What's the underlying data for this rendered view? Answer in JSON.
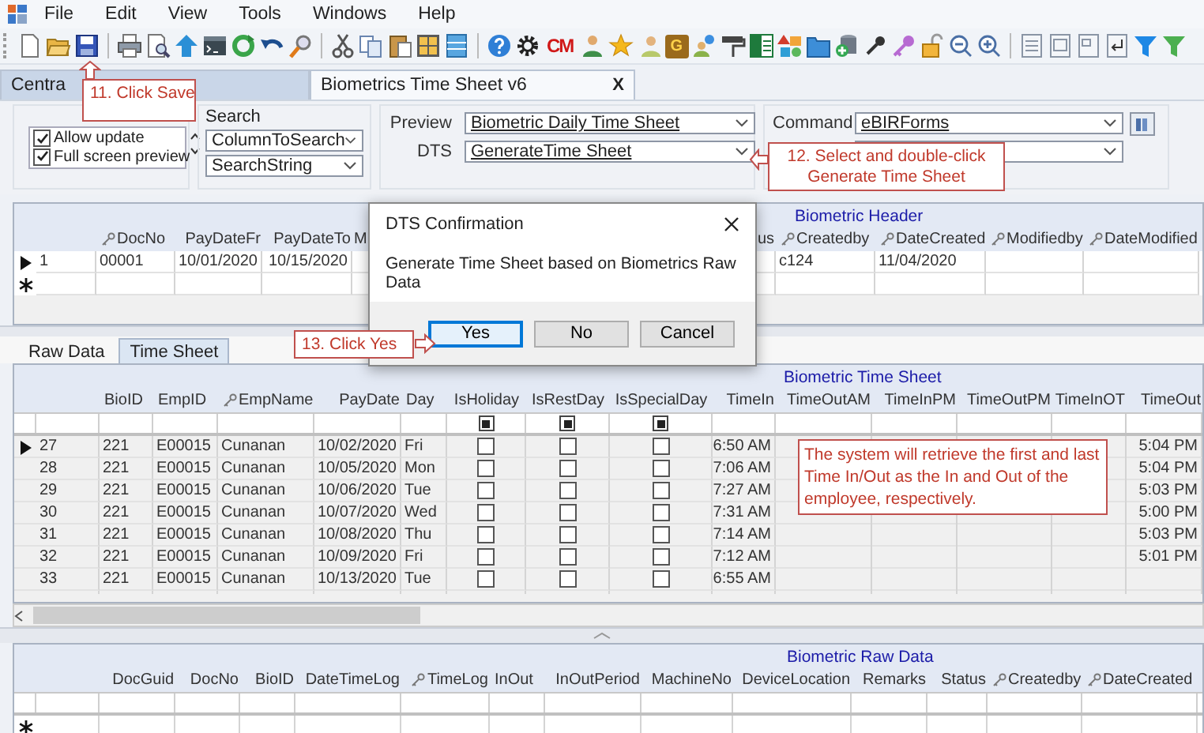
{
  "menu": [
    "File",
    "Edit",
    "View",
    "Tools",
    "Windows",
    "Help"
  ],
  "toolbar": {
    "cm_logo": "CM",
    "g_logo": "G"
  },
  "doc_tabs": [
    {
      "label": "Centra",
      "selected": false
    },
    {
      "label": "Biometrics Time Sheet v6",
      "selected": true,
      "close": "X"
    }
  ],
  "options": [
    {
      "label": "Allow update",
      "checked": true
    },
    {
      "label": "Full screen preview",
      "checked": true
    }
  ],
  "search": {
    "label": "Search",
    "column_field": "ColumnToSearch",
    "string_field": "SearchString"
  },
  "preview": {
    "label": "Preview",
    "value": "Biometric Daily Time Sheet"
  },
  "dts": {
    "label": "DTS",
    "value": "GenerateTime Sheet"
  },
  "command": {
    "label": "Command",
    "value": "eBIRForms"
  },
  "header_grid": {
    "title": "Biometric Header",
    "new_row": true,
    "columns": [
      {
        "label": "DocNo",
        "key": true,
        "kind": "text"
      },
      {
        "label": "PayDateFr",
        "key": false,
        "kind": "text"
      },
      {
        "label": "PayDateTo",
        "key": false,
        "kind": "text"
      },
      {
        "label": "M",
        "key": false,
        "kind": "text"
      },
      {
        "label": "us",
        "key": false,
        "kind": "text"
      },
      {
        "label": "Createdby",
        "key": true,
        "kind": "text"
      },
      {
        "label": "DateCreated",
        "key": true,
        "kind": "text"
      },
      {
        "label": "Modifiedby",
        "key": true,
        "kind": "text"
      },
      {
        "label": "DateModified",
        "key": true,
        "kind": "text"
      }
    ],
    "rows": [
      {
        "current": true,
        "number": "1",
        "cells": [
          "00001",
          "10/01/2020",
          "10/15/2020",
          null,
          null,
          "c124",
          "11/04/2020",
          null,
          null
        ]
      }
    ]
  },
  "dialog": {
    "title": "DTS Confirmation",
    "message": "Generate Time Sheet based on Biometrics Raw Data",
    "buttons": [
      {
        "label": "Yes",
        "focused": true
      },
      {
        "label": "No",
        "focused": false
      },
      {
        "label": "Cancel",
        "focused": false
      }
    ]
  },
  "sub_tabs": [
    {
      "label": "Raw Data",
      "selected": false
    },
    {
      "label": "Time Sheet",
      "selected": true
    }
  ],
  "time_sheet": {
    "title": "Biometric Time Sheet",
    "new_row": false,
    "columns": [
      {
        "label": "BioID",
        "key": false,
        "kind": "text"
      },
      {
        "label": "EmpID",
        "key": false,
        "kind": "text"
      },
      {
        "label": "EmpName",
        "key": true,
        "kind": "text"
      },
      {
        "label": "PayDate",
        "key": false,
        "kind": "text"
      },
      {
        "label": "Day",
        "key": false,
        "kind": "text"
      },
      {
        "label": "IsHoliday",
        "key": false,
        "kind": "check",
        "filter_indeterminate": true
      },
      {
        "label": "IsRestDay",
        "key": false,
        "kind": "check",
        "filter_indeterminate": true
      },
      {
        "label": "IsSpecialDay",
        "key": false,
        "kind": "check",
        "filter_indeterminate": true
      },
      {
        "label": "TimeIn",
        "key": false,
        "kind": "text"
      },
      {
        "label": "TimeOutAM",
        "key": false,
        "kind": "text"
      },
      {
        "label": "TimeInPM",
        "key": false,
        "kind": "text"
      },
      {
        "label": "TimeOutPM",
        "key": false,
        "kind": "text"
      },
      {
        "label": "TimeInOT",
        "key": false,
        "kind": "text"
      },
      {
        "label": "TimeOut",
        "key": false,
        "kind": "text"
      }
    ],
    "rows": [
      {
        "current": true,
        "number": "27",
        "cells": [
          "221",
          "E00015",
          "Cunanan",
          "10/02/2020",
          "Fri",
          false,
          false,
          false,
          "6:50 AM",
          null,
          null,
          null,
          null,
          "5:04 PM"
        ]
      },
      {
        "current": false,
        "number": "28",
        "cells": [
          "221",
          "E00015",
          "Cunanan",
          "10/05/2020",
          "Mon",
          false,
          false,
          false,
          "7:06 AM",
          null,
          null,
          null,
          null,
          "5:04 PM"
        ]
      },
      {
        "current": false,
        "number": "29",
        "cells": [
          "221",
          "E00015",
          "Cunanan",
          "10/06/2020",
          "Tue",
          false,
          false,
          false,
          "7:27 AM",
          null,
          null,
          null,
          null,
          "5:03 PM"
        ]
      },
      {
        "current": false,
        "number": "30",
        "cells": [
          "221",
          "E00015",
          "Cunanan",
          "10/07/2020",
          "Wed",
          false,
          false,
          false,
          "7:31 AM",
          null,
          null,
          null,
          null,
          "5:00 PM"
        ]
      },
      {
        "current": false,
        "number": "31",
        "cells": [
          "221",
          "E00015",
          "Cunanan",
          "10/08/2020",
          "Thu",
          false,
          false,
          false,
          "7:14 AM",
          null,
          null,
          null,
          null,
          "5:03 PM"
        ]
      },
      {
        "current": false,
        "number": "32",
        "cells": [
          "221",
          "E00015",
          "Cunanan",
          "10/09/2020",
          "Fri",
          false,
          false,
          false,
          "7:12 AM",
          null,
          null,
          null,
          null,
          "5:01 PM"
        ]
      },
      {
        "current": false,
        "number": "33",
        "cells": [
          "221",
          "E00015",
          "Cunanan",
          "10/13/2020",
          "Tue",
          false,
          false,
          false,
          "6:55 AM",
          null,
          null,
          null,
          null,
          null
        ]
      }
    ]
  },
  "raw_grid": {
    "title": "Biometric Raw Data",
    "new_row": true,
    "columns": [
      {
        "label": "DocGuid",
        "key": false
      },
      {
        "label": "DocNo",
        "key": false
      },
      {
        "label": "BioID",
        "key": false
      },
      {
        "label": "DateTimeLog",
        "key": false
      },
      {
        "label": "TimeLog",
        "key": true
      },
      {
        "label": "InOut",
        "key": false
      },
      {
        "label": "InOutPeriod",
        "key": false
      },
      {
        "label": "MachineNo",
        "key": false
      },
      {
        "label": "DeviceLocation",
        "key": false
      },
      {
        "label": "Remarks",
        "key": false
      },
      {
        "label": "Status",
        "key": false
      },
      {
        "label": "Createdby",
        "key": true
      },
      {
        "label": "DateCreated",
        "key": true
      }
    ]
  },
  "callouts": [
    {
      "kind": "save",
      "text": "11. Click Save"
    },
    {
      "kind": "dts",
      "text": "12. Select and double-click Generate Time Sheet"
    },
    {
      "kind": "yes",
      "text": "13. Click Yes"
    },
    {
      "kind": "note",
      "text": "The system will retrieve the first and last Time In/Out as the In and Out of the employee, respectively."
    }
  ]
}
